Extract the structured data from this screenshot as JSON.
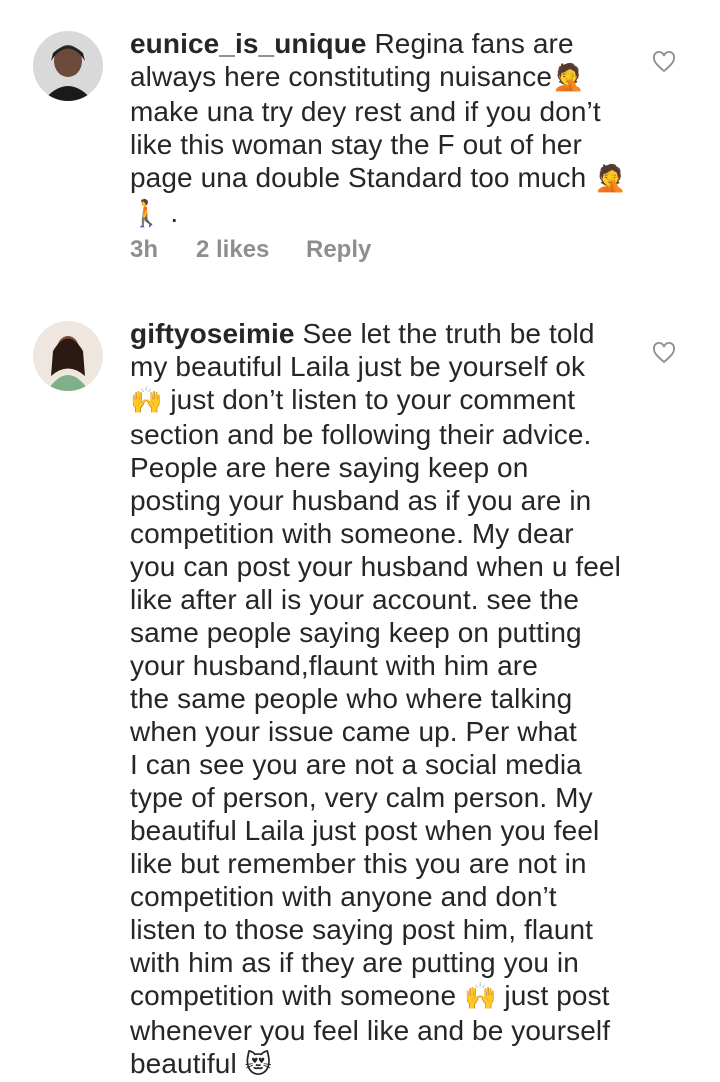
{
  "comments": [
    {
      "username": "eunice_is_unique",
      "lines": [
        " Regina fans are",
        "always here constituting nuisance",
        "make una try dey rest and if you don’t",
        "like this woman stay the F out of her",
        "page una double Standard too much "
      ],
      "emoji_facepalm": "🤦",
      "emoji_walk": "🚶",
      "trailing": ".",
      "time": "3h",
      "likes": "2 likes",
      "reply": "Reply",
      "like_icon": "heart-outline-icon"
    },
    {
      "username": "giftyoseimie",
      "lines": [
        " See let the truth be told",
        "my beautiful Laila just be yourself ok",
        " just don’t listen to your comment",
        "section and be following their advice.",
        "People are here saying keep on",
        "posting your husband as if you are in",
        "competition with someone. My dear",
        "you can post your husband when u feel",
        "like after all is your account. see the",
        "same people saying keep on putting",
        "your husband,flaunt with him are",
        "the same people who where talking",
        "when your issue came up. Per what",
        "I can see you are not a social media",
        "type of person, very calm person. My",
        "beautiful Laila just post when you feel",
        "like but remember this you are not in",
        "competition with anyone and don’t",
        "listen to those saying post him, flaunt",
        "with him as if they are putting you in",
        "competition with someone ",
        " just post",
        "whenever you feel like and be yourself",
        "beautiful "
      ],
      "emoji_hands": "🙌",
      "emoji_heart_eyes_cat": "😻",
      "like_icon": "heart-outline-icon"
    }
  ]
}
